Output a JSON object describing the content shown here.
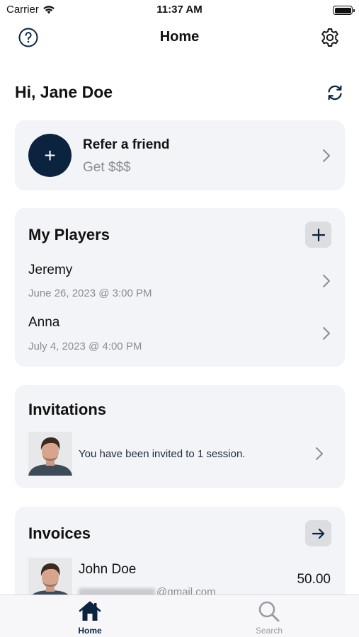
{
  "status_bar": {
    "carrier": "Carrier",
    "time": "11:37 AM"
  },
  "nav": {
    "title": "Home"
  },
  "greeting": "Hi, Jane Doe",
  "refer": {
    "title": "Refer a friend",
    "subtitle": "Get $$$"
  },
  "players": {
    "title": "My Players",
    "items": [
      {
        "name": "Jeremy",
        "date": "June 26, 2023 @ 3:00 PM"
      },
      {
        "name": "Anna",
        "date": "July 4, 2023 @ 4:00 PM"
      }
    ]
  },
  "invitations": {
    "title": "Invitations",
    "text": "You have been invited to 1 session."
  },
  "invoices": {
    "title": "Invoices",
    "items": [
      {
        "name": "John Doe",
        "email_suffix": "@gmail.com",
        "amount": "50.00"
      }
    ]
  },
  "tab_bar": {
    "home": "Home",
    "search": "Search"
  },
  "colors": {
    "accent": "#0c2340",
    "card_bg": "#f3f4f7",
    "muted_text": "#8a8d93"
  }
}
